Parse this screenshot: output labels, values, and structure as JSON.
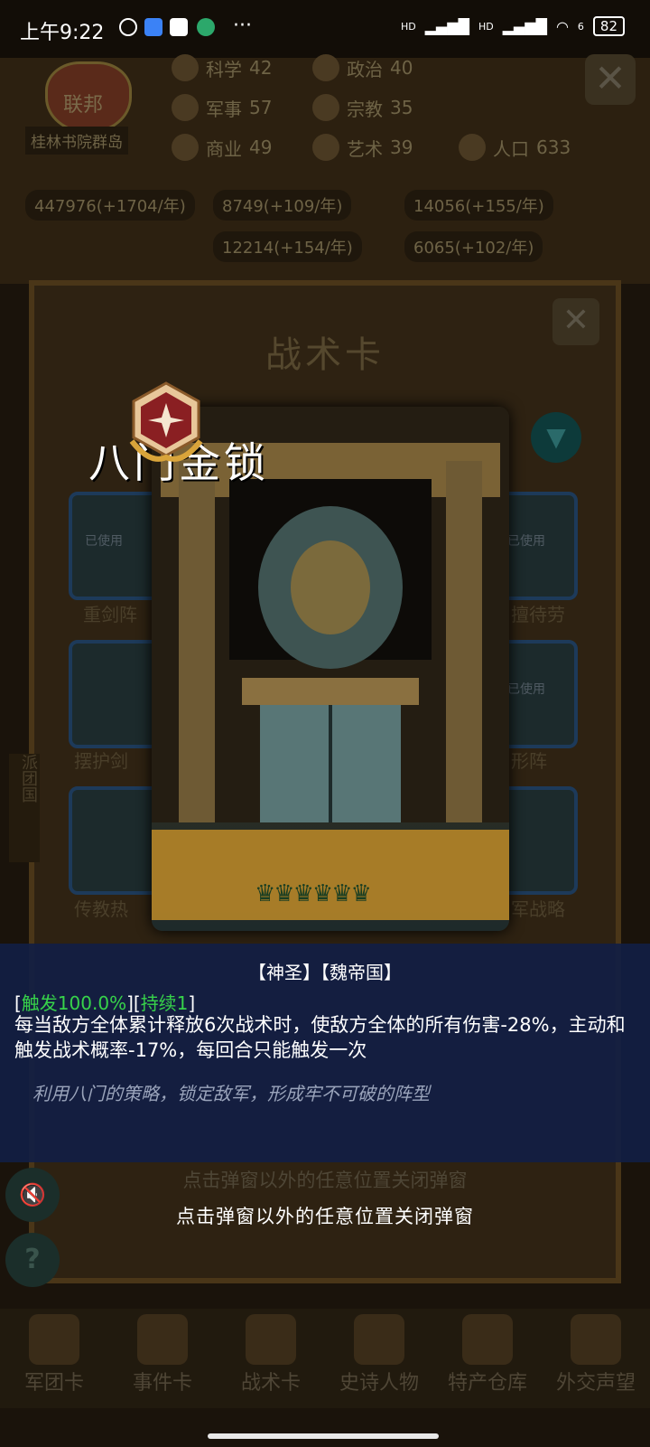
{
  "status_bar": {
    "time": "上午9:22",
    "network_hd1": "HD",
    "network_hd2": "HD",
    "wifi_label": "6",
    "battery": "82",
    "more": "···"
  },
  "hud": {
    "emblem_title": "联邦",
    "region": "桂林书院群岛",
    "stats": [
      {
        "icon": "science-icon",
        "label": "科学",
        "value": "42"
      },
      {
        "icon": "politics-icon",
        "label": "政治",
        "value": "40"
      },
      {
        "icon": "military-icon",
        "label": "军事",
        "value": "57"
      },
      {
        "icon": "religion-icon",
        "label": "宗教",
        "value": "35"
      },
      {
        "icon": "commerce-icon",
        "label": "商业",
        "value": "49"
      },
      {
        "icon": "art-icon",
        "label": "艺术",
        "value": "39"
      },
      {
        "icon": "population-icon",
        "label": "人口",
        "value": "633"
      }
    ],
    "resources": [
      {
        "icon": "gold-icon",
        "text": "447976(+1704/年)"
      },
      {
        "icon": "timber-icon",
        "text": "8749(+109/年)"
      },
      {
        "icon": "ore-icon",
        "text": "14056(+155/年)"
      },
      {
        "icon": "stone-icon",
        "text": "12214(+154/年)"
      },
      {
        "icon": "meat-icon",
        "text": "6065(+102/年)"
      }
    ]
  },
  "panel": {
    "title": "战术卡",
    "used_label": "已使用",
    "slots": [
      "重剑阵",
      "擅待劳",
      "摆护剑",
      "形阵",
      "传教热",
      "军战略"
    ],
    "side_label": "派团国"
  },
  "card": {
    "name": "八门金锁",
    "rarity_stars": 6,
    "art_description": "ornate golden gate"
  },
  "description": {
    "tags": "【神圣】【魏帝国】",
    "trigger_prefix": "[",
    "trigger": "触发100.0%",
    "mid": "][",
    "duration": "持续1",
    "suffix": "]",
    "effect": "每当敌方全体累计释放6次战术时，使敌方全体的所有伤害-28%，主动和触发战术概率-17%，每回合只能触发一次",
    "flavor": "利用八门的策略，锁定敌军，形成牢不可破的阵型"
  },
  "hint": "点击弹窗以外的任意位置关闭弹窗",
  "nav": [
    {
      "icon": "helmet-icon",
      "label": "军团卡"
    },
    {
      "icon": "scroll-icon",
      "label": "事件卡"
    },
    {
      "icon": "shield-icon",
      "label": "战术卡"
    },
    {
      "icon": "crown-icon",
      "label": "史诗人物"
    },
    {
      "icon": "chest-icon",
      "label": "特产仓库"
    },
    {
      "icon": "envelope-icon",
      "label": "外交声望"
    }
  ],
  "colors": {
    "trigger_green": "#37d34a",
    "desc_bg": "#121e44",
    "banner_gold": "#b98728"
  }
}
